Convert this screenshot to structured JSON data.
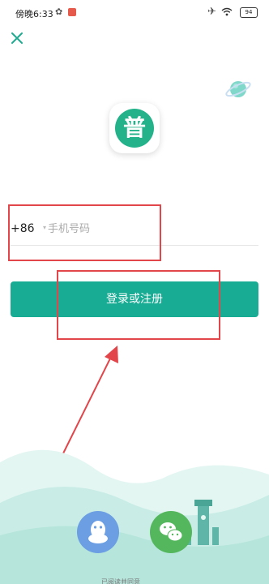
{
  "status_bar": {
    "time": "傍晚6:33",
    "battery": "94",
    "left_icons": [
      "flower-icon",
      "app-notification-icon"
    ],
    "right_icons": [
      "airplane-icon",
      "wifi-icon",
      "battery-icon"
    ]
  },
  "header": {
    "close_icon": "close-icon",
    "decoration": "planet-icon"
  },
  "logo": {
    "glyph": "普",
    "color": "#23b28a"
  },
  "phone": {
    "country_code": "+86",
    "placeholder": "手机号码",
    "value": ""
  },
  "login_button": {
    "label": "登录或注册",
    "color": "#17ac93"
  },
  "annotations": {
    "highlight_color": "#e2454a",
    "arrow_icon": "red-arrow"
  },
  "social_login": [
    {
      "name": "qq",
      "icon": "qq-icon",
      "color": "#6b9ee3"
    },
    {
      "name": "wechat",
      "icon": "wechat-icon",
      "color": "#55b75d"
    }
  ],
  "agreement": {
    "text": "已阅读并同意"
  }
}
